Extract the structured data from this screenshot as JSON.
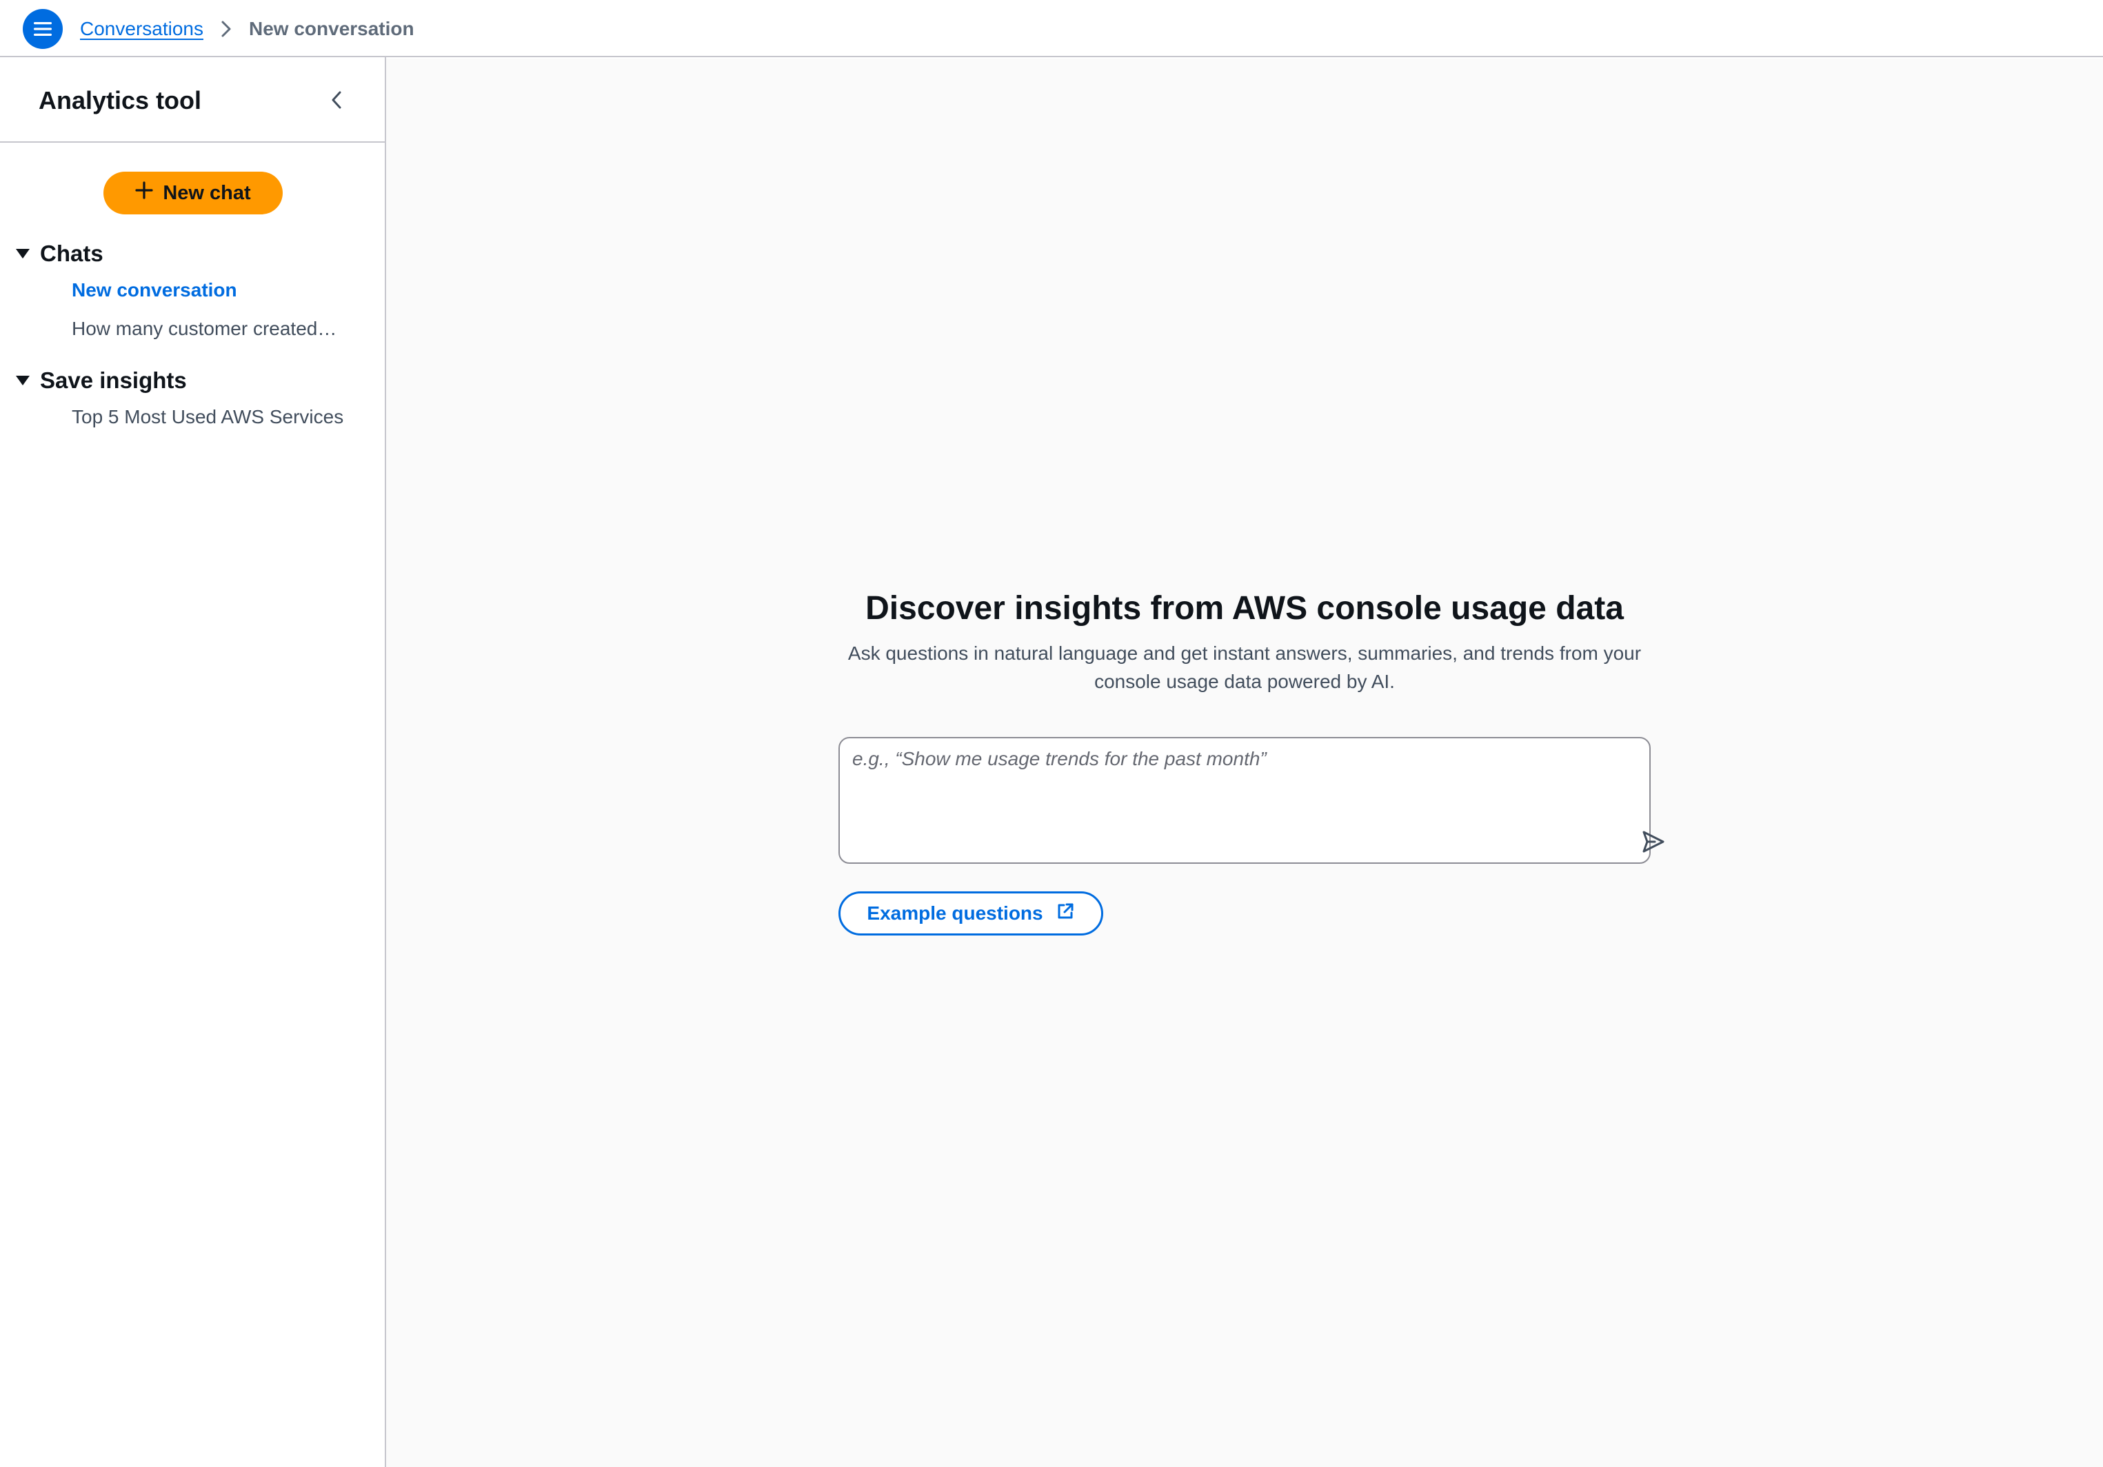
{
  "header": {
    "menu_icon": "hamburger-menu-icon",
    "breadcrumb": {
      "parent_label": "Conversations",
      "separator_icon": "chevron-right-icon",
      "current_label": "New conversation"
    }
  },
  "sidebar": {
    "title": "Analytics tool",
    "collapse_icon": "chevron-left-icon",
    "new_chat": {
      "icon": "plus-icon",
      "label": "New chat"
    },
    "sections": [
      {
        "label": "Chats",
        "expanded": true,
        "items": [
          {
            "label": "New conversation",
            "active": true
          },
          {
            "label": "How many customer created…",
            "active": false
          }
        ]
      },
      {
        "label": "Save insights",
        "expanded": true,
        "items": [
          {
            "label": "Top 5 Most Used AWS Services",
            "active": false
          }
        ]
      }
    ]
  },
  "main": {
    "headline": "Discover insights from AWS console usage data",
    "subtext": "Ask questions in natural language and get instant answers, summaries, and trends from your console usage data powered by AI.",
    "prompt": {
      "value": "",
      "placeholder": "e.g., “Show me usage trends for the past month”",
      "send_icon": "send-icon"
    },
    "example_button": {
      "label": "Example questions",
      "icon": "external-link-icon"
    }
  },
  "colors": {
    "accent": "#006ce0",
    "primary_button": "#ff9900",
    "border": "#c6c6cd",
    "main_background": "#fafafa"
  }
}
